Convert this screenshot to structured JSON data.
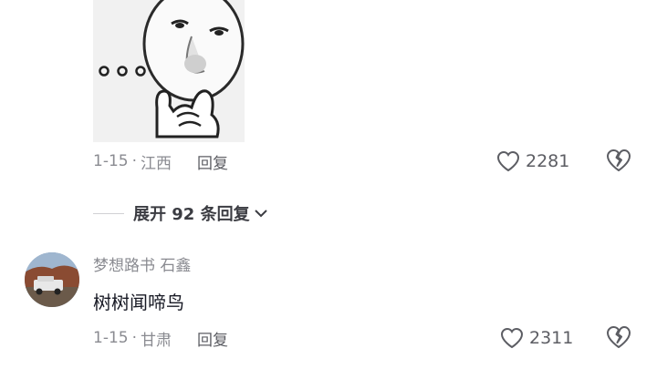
{
  "comment1": {
    "sticker_alt": "thinking-face-sticker",
    "date": "1-15",
    "region": "江西",
    "reply_label": "回复",
    "likes": "2281"
  },
  "expand": {
    "label": "展开 92 条回复"
  },
  "comment2": {
    "username": "梦想路书 石鑫",
    "text": "树树闻啼鸟",
    "date": "1-15",
    "region": "甘肃",
    "reply_label": "回复",
    "likes": "2311"
  },
  "icons": {
    "like": "heart-outline-icon",
    "dislike": "broken-heart-icon",
    "expand": "chevron-down-icon"
  },
  "colors": {
    "meta_gray": "#8a8b91",
    "icon_gray": "#5c5d63",
    "text_dark": "#161823"
  }
}
